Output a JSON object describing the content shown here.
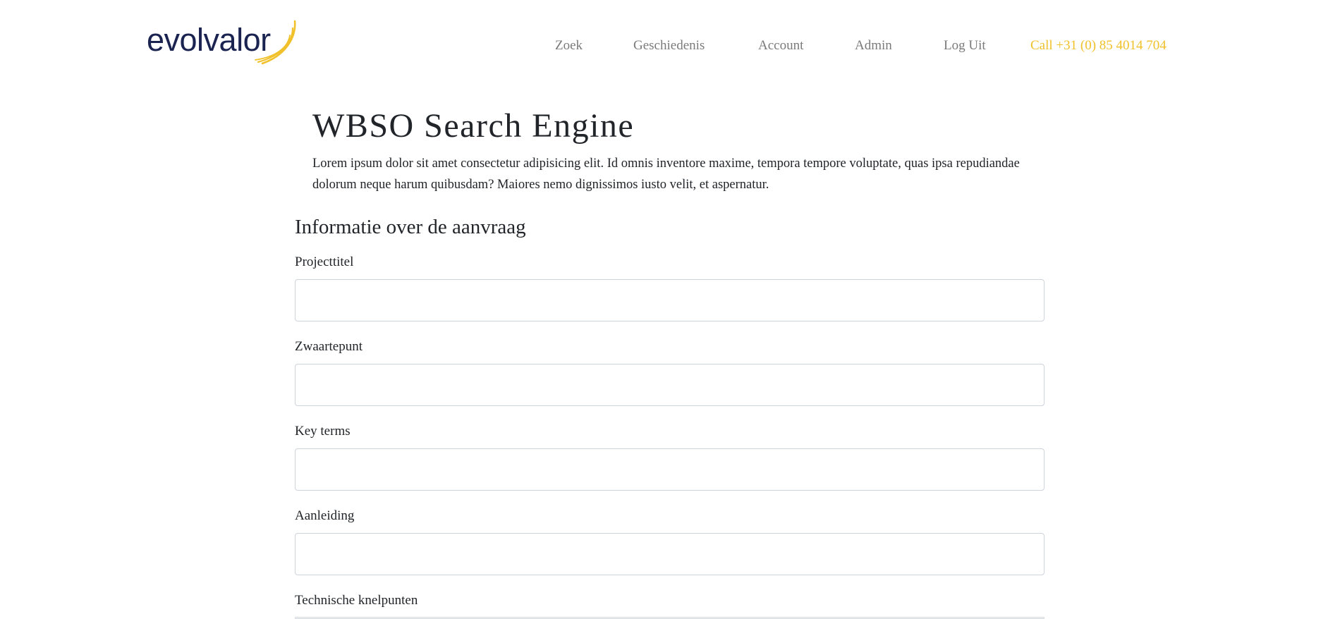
{
  "header": {
    "logo_text": "evolvalor",
    "brand_colors": {
      "navy": "#1b2451",
      "gold": "#f0c12a"
    },
    "nav": {
      "items": [
        {
          "label": "Zoek"
        },
        {
          "label": "Geschiedenis"
        },
        {
          "label": "Account"
        },
        {
          "label": "Admin"
        },
        {
          "label": "Log Uit"
        }
      ],
      "call_label": "Call +31 (0) 85 4014 704"
    }
  },
  "main": {
    "title": "WBSO Search Engine",
    "intro": "Lorem ipsum dolor sit amet consectetur adipisicing elit. Id omnis inventore maxime, tempora tempore voluptate, quas ipsa repudiandae dolorum neque harum quibusdam? Maiores nemo dignissimos iusto velit, et aspernatur.",
    "section_title": "Informatie over de aanvraag",
    "fields": [
      {
        "label": "Projecttitel",
        "value": ""
      },
      {
        "label": "Zwaartepunt",
        "value": ""
      },
      {
        "label": "Key terms",
        "value": ""
      },
      {
        "label": "Aanleiding",
        "value": ""
      },
      {
        "label": "Technische knelpunten",
        "value": ""
      }
    ]
  }
}
